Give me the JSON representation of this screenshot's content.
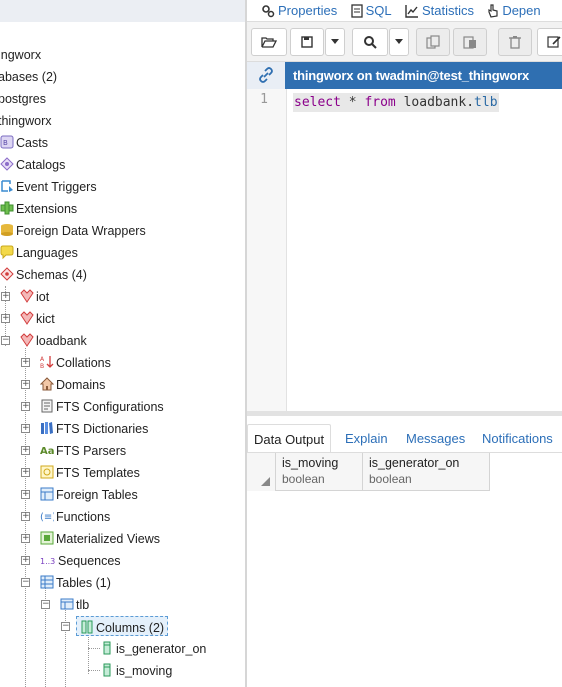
{
  "tree": {
    "partial_nodes": [
      "ingworx",
      "abases (2)",
      "postgres",
      "thingworx"
    ],
    "db_items": [
      "Casts",
      "Catalogs",
      "Event Triggers",
      "Extensions",
      "Foreign Data Wrappers",
      "Languages",
      "Schemas (4)"
    ],
    "schemas": [
      "iot",
      "kict",
      "loadbank"
    ],
    "loadbank_items": [
      "Collations",
      "Domains",
      "FTS Configurations",
      "FTS Dictionaries",
      "FTS Parsers",
      "FTS Templates",
      "Foreign Tables",
      "Functions",
      "Materialized Views",
      "Sequences",
      "Tables (1)"
    ],
    "table": "tlb",
    "columns_label": "Columns (2)",
    "columns": [
      "is_generator_on",
      "is_moving"
    ]
  },
  "tabs": [
    "Properties",
    "SQL",
    "Statistics",
    "Depen"
  ],
  "toolbar": {
    "buttons": [
      "open-file",
      "save",
      "save-dropdown",
      "find",
      "find-dropdown",
      "copy",
      "paste",
      "delete",
      "edit"
    ]
  },
  "connection": {
    "title": "thingworx on twadmin@test_thingworx"
  },
  "editor": {
    "line_number": "1",
    "query": {
      "kw1": "select",
      "op": "*",
      "kw2": "from",
      "schema": "loadbank.",
      "table": "tlb"
    }
  },
  "output_tabs": [
    "Data Output",
    "Explain",
    "Messages",
    "Notifications"
  ],
  "grid": {
    "columns": [
      {
        "name": "is_moving",
        "type": "boolean"
      },
      {
        "name": "is_generator_on",
        "type": "boolean"
      }
    ]
  },
  "colors": {
    "accent": "#2f6fb1",
    "link": "#2c6fb8",
    "keyword": "#8b008b"
  }
}
